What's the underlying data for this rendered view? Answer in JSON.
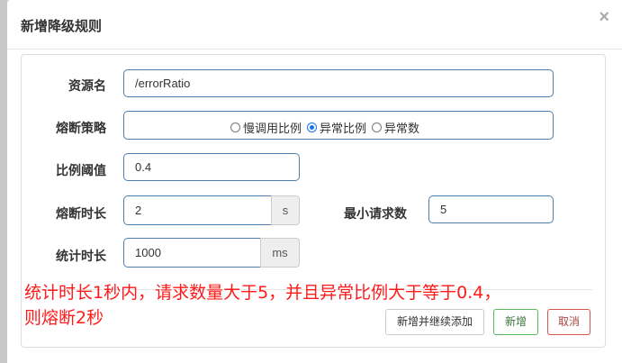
{
  "dialog": {
    "title": "新增降级规则",
    "close_glyph": "×"
  },
  "form": {
    "resource": {
      "label": "资源名",
      "value": "/errorRatio"
    },
    "strategy": {
      "label": "熔断策略",
      "options": [
        {
          "label": "慢调用比例",
          "checked": false
        },
        {
          "label": "异常比例",
          "checked": true
        },
        {
          "label": "异常数",
          "checked": false
        }
      ]
    },
    "ratio_threshold": {
      "label": "比例阈值",
      "value": "0.4"
    },
    "break_duration": {
      "label": "熔断时长",
      "value": "2",
      "unit": "s"
    },
    "min_requests": {
      "label": "最小请求数",
      "value": "5"
    },
    "stat_duration": {
      "label": "统计时长",
      "value": "1000",
      "unit": "ms"
    }
  },
  "annotation": {
    "line1": "统计时长1秒内，请求数量大于5，并且异常比例大于等于0.4，",
    "line2": "则熔断2秒",
    "color": "#ff1a1a"
  },
  "footer": {
    "add_continue_label": "新增并继续添加",
    "add_label": "新增",
    "cancel_label": "取消"
  }
}
